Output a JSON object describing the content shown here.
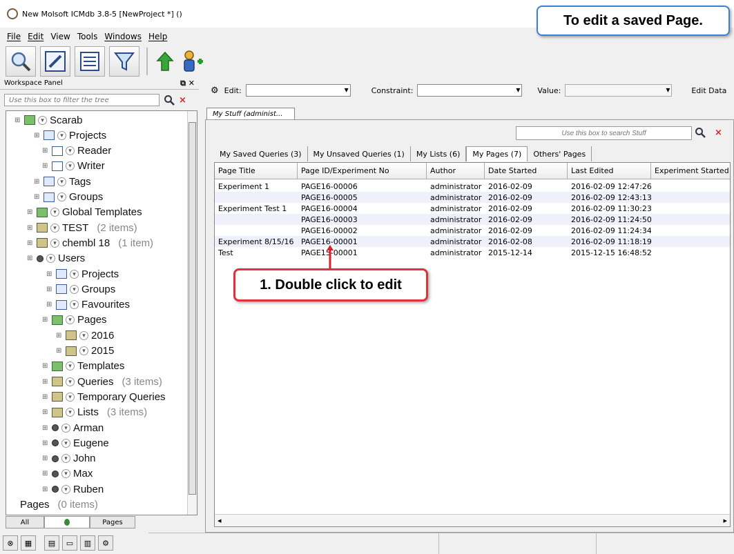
{
  "window": {
    "title": "New Molsoft ICMdb 3.8-5  [NewProject *] ()"
  },
  "callouts": {
    "top": "To edit a saved Page.",
    "step1": "1. Double click to edit"
  },
  "menu": [
    "File",
    "Edit",
    "View",
    "Tools",
    "Windows",
    "Help"
  ],
  "toolbar": {
    "icons": [
      "search-icon",
      "edit-icon",
      "list-icon",
      "filter-icon",
      "upload-icon",
      "add-user-icon"
    ]
  },
  "workspace": {
    "title": "Workspace Panel",
    "filter_placeholder": "Use this box to filter the tree",
    "tree": [
      {
        "label": "Scarab",
        "count": "",
        "icon": "tmpl"
      },
      {
        "label": "Projects",
        "count": "",
        "icon": "proj"
      },
      {
        "label": "Reader",
        "count": "",
        "icon": "doc"
      },
      {
        "label": "Writer",
        "count": "",
        "icon": "doc"
      },
      {
        "label": "Tags",
        "count": "",
        "icon": "proj"
      },
      {
        "label": "Groups",
        "count": "",
        "icon": "proj"
      },
      {
        "label": "Global Templates",
        "count": "",
        "icon": "tmpl"
      },
      {
        "label": "TEST",
        "count": "(2 items)",
        "icon": "folder"
      },
      {
        "label": "chembl 18",
        "count": "(1 item)",
        "icon": "folder"
      },
      {
        "label": "Users",
        "count": "",
        "icon": "user"
      },
      {
        "label": "Projects",
        "count": "",
        "icon": "proj"
      },
      {
        "label": "Groups",
        "count": "",
        "icon": "proj"
      },
      {
        "label": "Favourites",
        "count": "",
        "icon": "proj"
      },
      {
        "label": "Pages",
        "count": "",
        "icon": "tmpl"
      },
      {
        "label": "2016",
        "count": "",
        "icon": "folder"
      },
      {
        "label": "2015",
        "count": "",
        "icon": "folder"
      },
      {
        "label": "Templates",
        "count": "",
        "icon": "tmpl"
      },
      {
        "label": "Queries",
        "count": "(3 items)",
        "icon": "folder"
      },
      {
        "label": "Temporary Queries",
        "count": "",
        "icon": "folder"
      },
      {
        "label": "Lists",
        "count": "(3 items)",
        "icon": "folder"
      },
      {
        "label": "Arman",
        "count": "",
        "icon": "user"
      },
      {
        "label": "Eugene",
        "count": "",
        "icon": "user"
      },
      {
        "label": "John",
        "count": "",
        "icon": "user"
      },
      {
        "label": "Max",
        "count": "",
        "icon": "user"
      },
      {
        "label": "Ruben",
        "count": "",
        "icon": "user"
      },
      {
        "label": "Pages",
        "count": "(0 items)",
        "icon": "none"
      }
    ],
    "tabs": [
      "All",
      "",
      "Pages"
    ]
  },
  "edit_bar": {
    "edit_label": "Edit:",
    "constraint_label": "Constraint:",
    "value_label": "Value:",
    "edit_data_label": "Edit Data"
  },
  "document_tab": "My Stuff (administ...",
  "stuff": {
    "search_placeholder": "Use this box to search Stuff",
    "tabs": [
      "My Saved Queries (3)",
      "My Unsaved Queries (1)",
      "My Lists (6)",
      "My Pages (7)",
      "Others' Pages"
    ],
    "active_tab": "My Pages (7)",
    "columns": [
      "Page Title",
      "Page ID/Experiment No",
      "Author",
      "Date Started",
      "Last Edited",
      "Experiment Started"
    ],
    "rows": [
      [
        "Experiment 1",
        "PAGE16-00006",
        "administrator",
        "2016-02-09",
        "2016-02-09 12:47:26",
        ""
      ],
      [
        "",
        "PAGE16-00005",
        "administrator",
        "2016-02-09",
        "2016-02-09 12:43:13",
        ""
      ],
      [
        "Experiment Test 1",
        "PAGE16-00004",
        "administrator",
        "2016-02-09",
        "2016-02-09 11:30:23",
        ""
      ],
      [
        "",
        "PAGE16-00003",
        "administrator",
        "2016-02-09",
        "2016-02-09 11:24:50",
        ""
      ],
      [
        "",
        "PAGE16-00002",
        "administrator",
        "2016-02-09",
        "2016-02-09 11:24:34",
        ""
      ],
      [
        "Experiment 8/15/16",
        "PAGE16-00001",
        "administrator",
        "2016-02-08",
        "2016-02-09 11:18:19",
        ""
      ],
      [
        "Test",
        "PAGE15-00001",
        "administrator",
        "2015-12-14",
        "2015-12-15 16:48:52",
        ""
      ]
    ]
  },
  "colors": {
    "callout_blue": "#3d7fd4",
    "callout_red": "#e0323a",
    "arrow_red": "#d81f2a",
    "row_alt": "#eef0fb"
  }
}
